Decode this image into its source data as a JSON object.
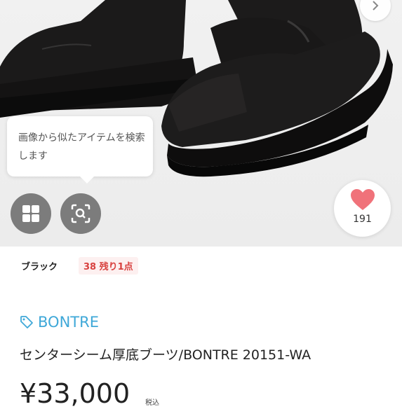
{
  "hero": {
    "tooltip_text": "画像から似たアイテムを検索します",
    "next_icon": "chevron-right-icon",
    "layout_icon": "grid-icon",
    "image_search_icon": "scan-search-icon"
  },
  "like": {
    "count": "191",
    "icon": "heart-icon",
    "color": "#f0727a"
  },
  "variant": {
    "color": "ブラック",
    "size_stock": "38 残り1点"
  },
  "product": {
    "brand": "BONTRE",
    "brand_icon": "tag-icon",
    "title": "センターシーム厚底ブーツ/BONTRE 20151-WA",
    "price": "¥33,000",
    "tax_note": "税込"
  },
  "colors": {
    "accent": "#3fa8d8",
    "stock_warning": "#d8413f"
  }
}
